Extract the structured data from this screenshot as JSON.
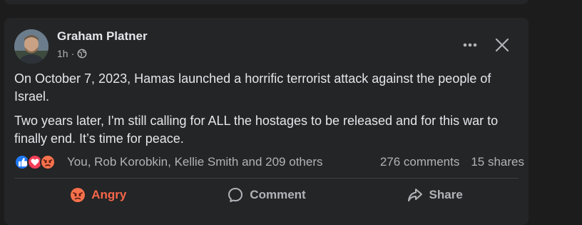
{
  "post": {
    "author": "Graham Platner",
    "time": "1h",
    "separator": "·",
    "icons": {
      "audience": "globe-icon",
      "more": "more-horizontal-icon",
      "close": "close-icon"
    },
    "paragraphs": [
      "On October 7, 2023, Hamas launched a horrific terrorist attack against the people of Israel.",
      "Two years later, I'm still calling for ALL the hostages to be released and for this war to finally end. It’s time for peace."
    ]
  },
  "reactions": {
    "icons": [
      "like-icon",
      "love-icon",
      "angry-icon"
    ],
    "colors": {
      "like": "#2078f4",
      "love": "#f33e58",
      "angry": "#f7714c"
    },
    "names": "You, Rob Korobkin, Kellie Smith and 209 others",
    "comments": "276 comments",
    "shares": "15 shares"
  },
  "actions": {
    "reaction_label": "Angry",
    "reaction_color": "#f7664a",
    "comment_label": "Comment",
    "share_label": "Share"
  }
}
